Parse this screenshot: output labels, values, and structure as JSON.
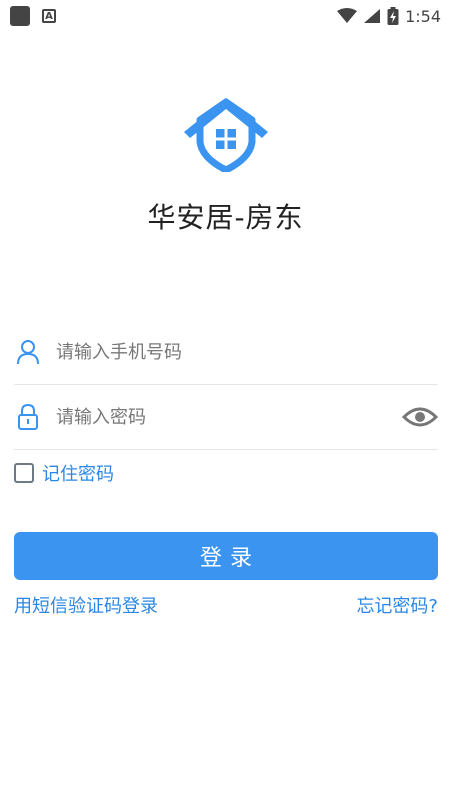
{
  "status_bar": {
    "time": "1:54",
    "left_icons": [
      "notification-square-icon",
      "keyboard-a-icon"
    ],
    "right_icons": [
      "wifi-icon",
      "signal-icon",
      "battery-charging-icon"
    ]
  },
  "app": {
    "title": "华安居-房东",
    "logo_icon": "house-shield-logo-icon",
    "accent_color": "#3b94f0"
  },
  "form": {
    "phone": {
      "placeholder": "请输入手机号码",
      "value": "",
      "icon": "user-icon"
    },
    "password": {
      "placeholder": "请输入密码",
      "value": "",
      "icon": "lock-icon",
      "toggle_icon": "eye-icon"
    },
    "remember": {
      "label": "记住密码",
      "checked": false
    },
    "login_label": "登录"
  },
  "links": {
    "sms_login": "用短信验证码登录",
    "forgot_password": "忘记密码?"
  }
}
